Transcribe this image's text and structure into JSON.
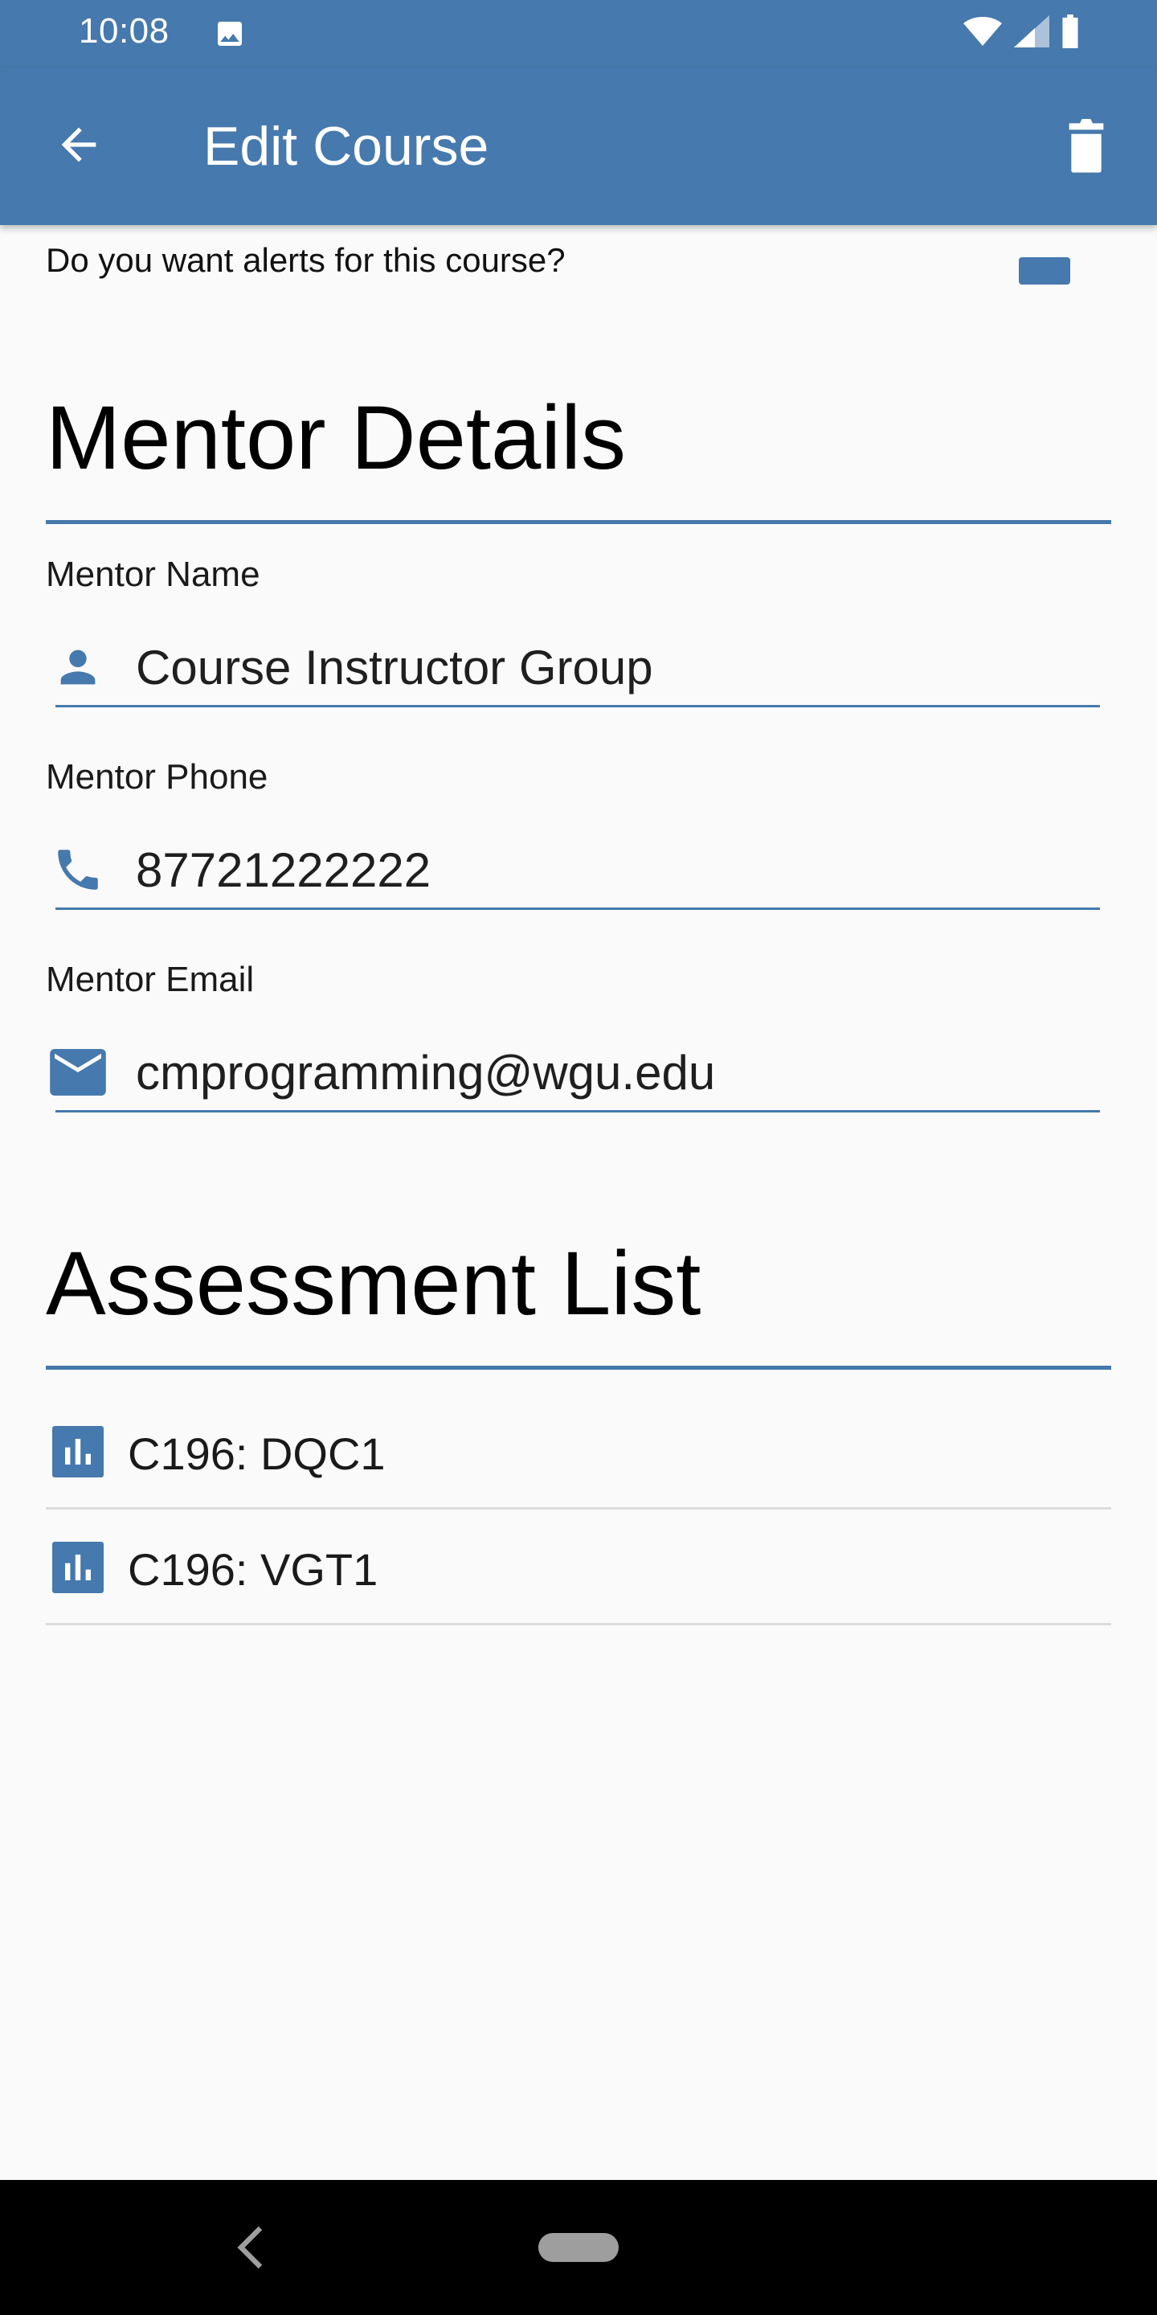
{
  "status_bar": {
    "time": "10:08",
    "icons": [
      "image-icon",
      "wifi-icon",
      "signal-icon",
      "battery-icon"
    ]
  },
  "app_bar": {
    "title": "Edit Course",
    "back_icon": "arrow-back-icon",
    "delete_icon": "trash-icon",
    "color": "#4679ad"
  },
  "alerts_row": {
    "text": "Do you want alerts for this course?"
  },
  "mentor_section": {
    "title": "Mentor Details",
    "fields": [
      {
        "label": "Mentor Name",
        "value": "Course Instructor Group",
        "icon": "person-icon"
      },
      {
        "label": "Mentor Phone",
        "value": "87721222222",
        "icon": "phone-icon"
      },
      {
        "label": "Mentor Email",
        "value": "cmprogramming@wgu.edu",
        "icon": "email-icon"
      }
    ]
  },
  "assessment_section": {
    "title": "Assessment List",
    "items": [
      {
        "label": "C196: DQC1",
        "icon": "bar-chart-icon"
      },
      {
        "label": "C196: VGT1",
        "icon": "bar-chart-icon"
      }
    ]
  },
  "nav_bar": {
    "back_icon": "nav-back-icon",
    "home_icon": "home-pill-icon"
  }
}
